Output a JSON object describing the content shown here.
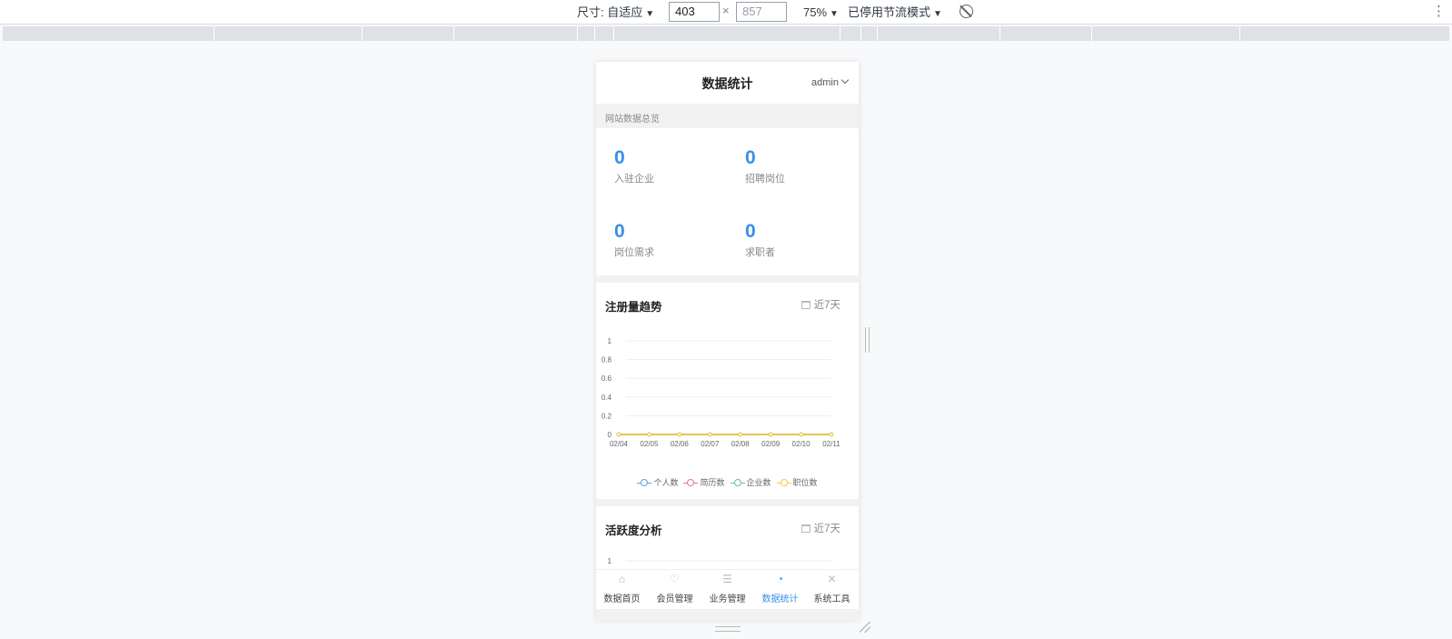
{
  "devtools": {
    "size_label": "尺寸: 自适应",
    "width": "403",
    "height_placeholder": "857",
    "zoom": "75%",
    "throttle": "已停用节流模式",
    "caret": "▼",
    "times": "×",
    "more": "⋮"
  },
  "app": {
    "title": "数据统计",
    "user": "admin",
    "overview_title": "网站数据总览",
    "stats": [
      {
        "value": "0",
        "label": "入驻企业"
      },
      {
        "value": "0",
        "label": "招聘岗位"
      },
      {
        "value": "0",
        "label": "岗位需求"
      },
      {
        "value": "0",
        "label": "求职者"
      }
    ],
    "trend_card": {
      "title": "注册量趋势",
      "range": "近7天"
    },
    "activity_card": {
      "title": "活跃度分析",
      "range": "近7天"
    },
    "tabs": [
      {
        "label": "数据首页",
        "icon": "home-icon",
        "glyph": "⌂"
      },
      {
        "label": "会员管理",
        "icon": "member-icon",
        "glyph": "♡"
      },
      {
        "label": "业务管理",
        "icon": "business-icon",
        "glyph": "☰"
      },
      {
        "label": "数据统计",
        "icon": "pie-chart-icon",
        "glyph": "◔"
      },
      {
        "label": "系统工具",
        "icon": "tools-icon",
        "glyph": "✕"
      }
    ]
  },
  "colors": {
    "accent": "#3a8ee6",
    "series_personal": "#5aa0e6",
    "series_resume": "#e8739b",
    "series_company": "#66c28a",
    "series_position": "#f2cf3a"
  },
  "chart_data": [
    {
      "type": "line",
      "title": "注册量趋势",
      "categories": [
        "02/04",
        "02/05",
        "02/06",
        "02/07",
        "02/08",
        "02/09",
        "02/10",
        "02/11"
      ],
      "yticks": [
        "0",
        "0.2",
        "0.4",
        "0.6",
        "0.8",
        "1"
      ],
      "ylim": [
        0,
        1
      ],
      "grid": true,
      "legend_placement": "bottom",
      "series": [
        {
          "name": "个人数",
          "values": [
            0,
            0,
            0,
            0,
            0,
            0,
            0,
            0
          ]
        },
        {
          "name": "简历数",
          "values": [
            0,
            0,
            0,
            0,
            0,
            0,
            0,
            0
          ]
        },
        {
          "name": "企业数",
          "values": [
            0,
            0,
            0,
            0,
            0,
            0,
            0,
            0
          ]
        },
        {
          "name": "职位数",
          "values": [
            0,
            0,
            0,
            0,
            0,
            0,
            0,
            0
          ]
        }
      ]
    },
    {
      "type": "line",
      "title": "活跃度分析",
      "yticks": [
        "1"
      ],
      "ylim": [
        0,
        1
      ]
    }
  ]
}
